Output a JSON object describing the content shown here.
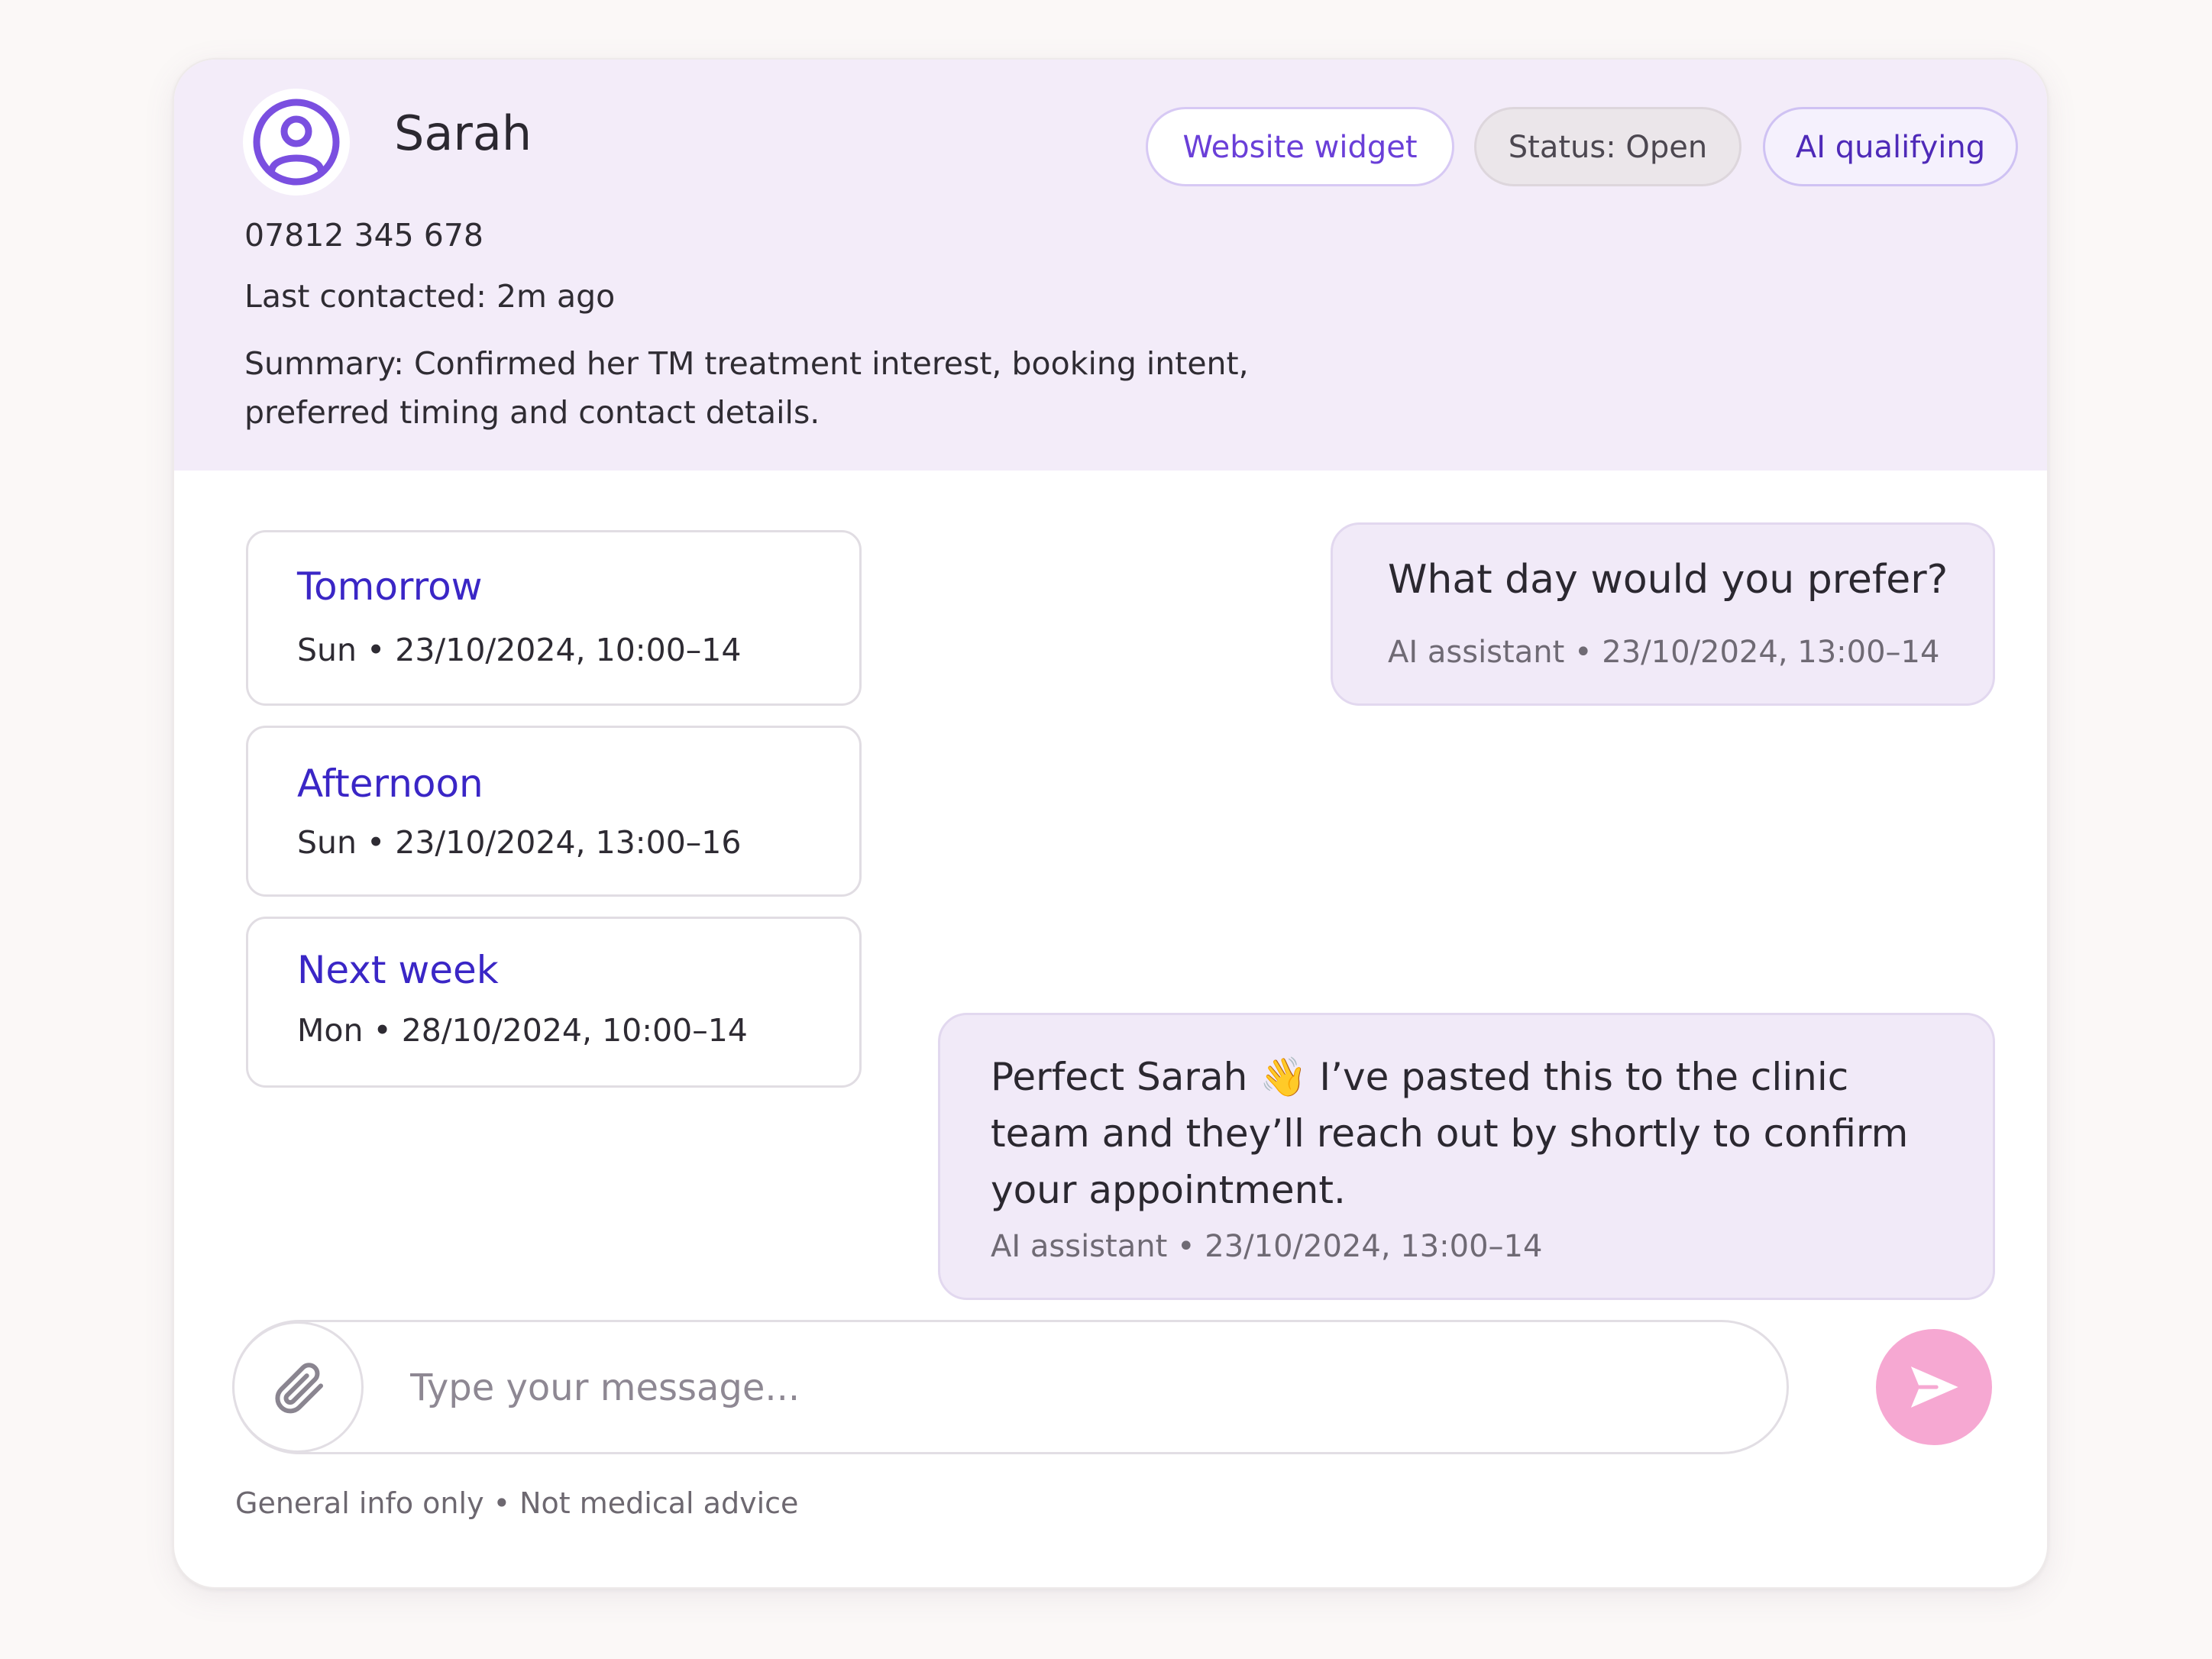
{
  "contact": {
    "name": "Sarah",
    "phone": "07812 345 678",
    "last_contacted": "Last contacted: 2m ago",
    "summary": "Summary: Confirmed her TM treatment interest, booking intent, preferred timing and contact details."
  },
  "badges": {
    "source": "Website widget",
    "status": "Status: Open",
    "ai": "AI qualifying"
  },
  "options": [
    {
      "title": "Tomorrow",
      "subtitle": "Sun • 23/10/2024, 10:00–14"
    },
    {
      "title": "Afternoon",
      "subtitle": "Sun • 23/10/2024, 13:00–16"
    },
    {
      "title": "Next week",
      "subtitle": "Mon • 28/10/2024, 10:00–14"
    }
  ],
  "messages": [
    {
      "text": "What day would you prefer?",
      "meta": "AI assistant • 23/10/2024, 13:00–14"
    },
    {
      "text_before": "Perfect Sarah",
      "emoji": "👋",
      "text_after": "I’ve pasted this to the clinic team and they’ll reach out by shortly to confirm your appointment.",
      "meta": "AI assistant • 23/10/2024, 13:00–14"
    }
  ],
  "composer": {
    "placeholder": "Type your message...",
    "attach_icon": "paperclip-icon",
    "send_icon": "send-icon"
  },
  "footer": {
    "disclaimer": "General info only • Not medical advice"
  },
  "colors": {
    "header_bg": "#f3ecf9",
    "accent_purple": "#6a3fd8",
    "option_title": "#3a26c6",
    "send_button": "#f6a8d2",
    "bubble_bg": "#f1eaf8"
  }
}
